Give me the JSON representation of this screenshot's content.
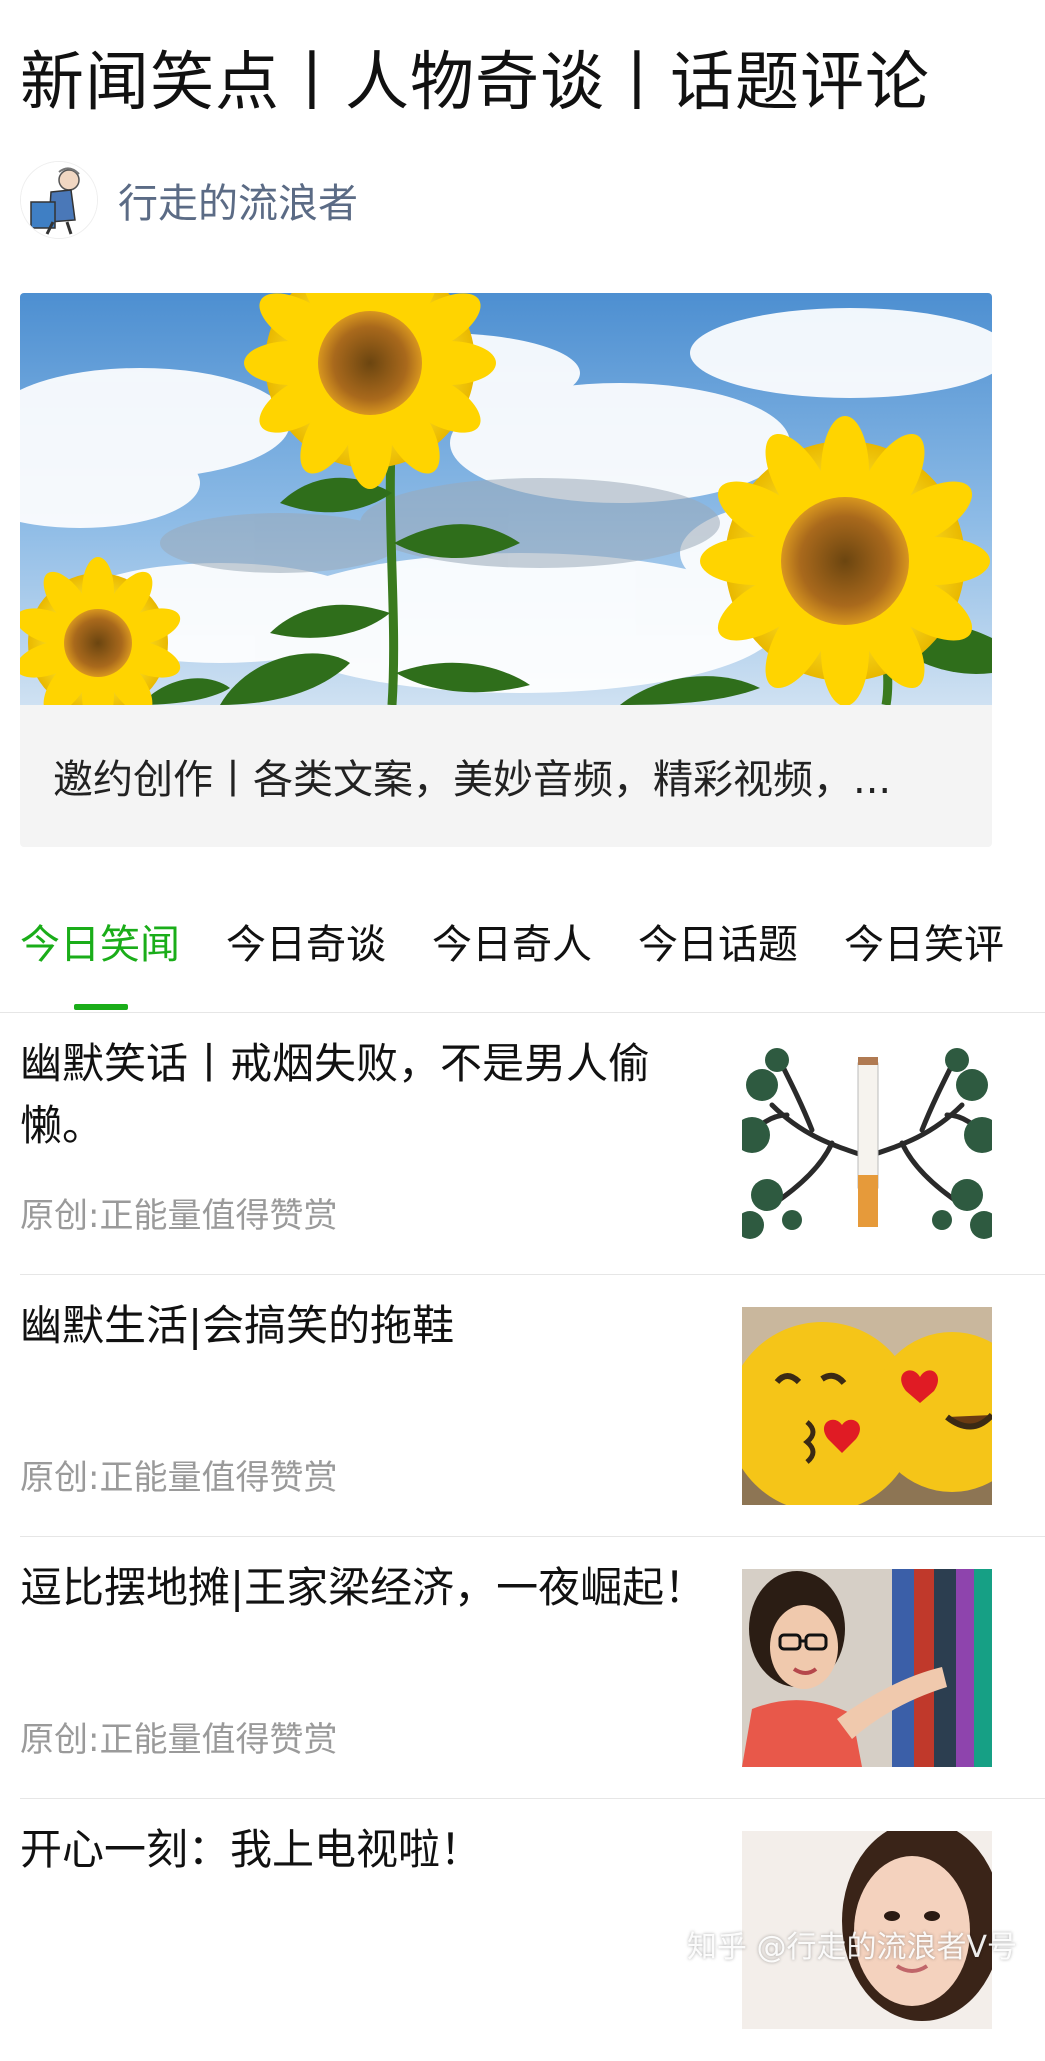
{
  "header": {
    "title": "新闻笑点丨人物奇谈丨话题评论",
    "author_name": "行走的流浪者"
  },
  "banner": {
    "caption": "邀约创作丨各类文案，美妙音频，精彩视频，..."
  },
  "tabs": [
    {
      "label": "今日笑闻",
      "active": true
    },
    {
      "label": "今日奇谈",
      "active": false
    },
    {
      "label": "今日奇人",
      "active": false
    },
    {
      "label": "今日话题",
      "active": false
    },
    {
      "label": "今日笑评",
      "active": false
    }
  ],
  "articles": [
    {
      "title": "幽默笑话丨戒烟失败，不是男人偷懒。",
      "meta": "原创:正能量值得赞赏"
    },
    {
      "title": "幽默生活|会搞笑的拖鞋",
      "meta": "原创:正能量值得赞赏"
    },
    {
      "title": "逗比摆地摊|王家梁经济，一夜崛起！",
      "meta": "原创:正能量值得赞赏"
    },
    {
      "title": "开心一刻：我上电视啦！",
      "meta": ""
    }
  ],
  "watermark": "知乎 @行走的流浪者V号",
  "colors": {
    "accent": "#1aad19",
    "author": "#5b6b85",
    "meta": "#9a9a9a"
  }
}
